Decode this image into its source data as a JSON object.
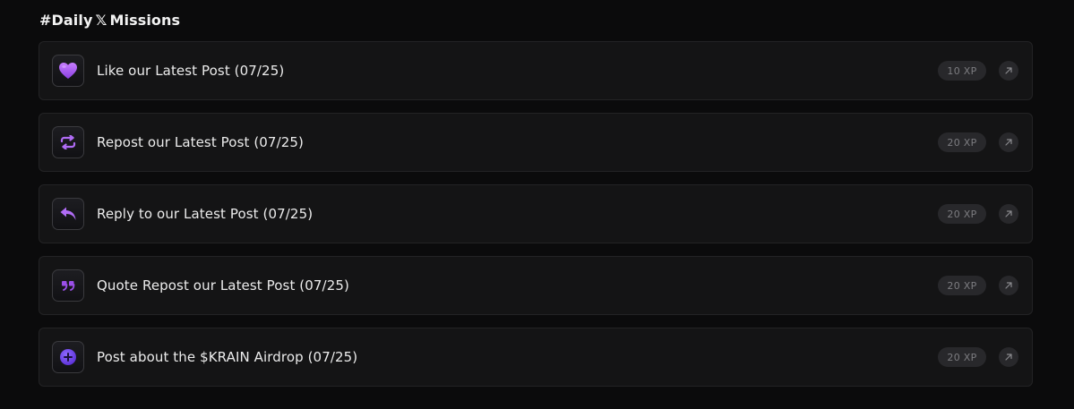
{
  "section": {
    "title_prefix": "#Daily",
    "title_x": "𝕏",
    "title_suffix": "Missions"
  },
  "missions": [
    {
      "label": "Like our Latest Post (07/25)",
      "xp": "10 XP",
      "icon": "purple-heart-icon"
    },
    {
      "label": "Repost our Latest Post (07/25)",
      "xp": "20 XP",
      "icon": "repost-icon"
    },
    {
      "label": "Reply to our Latest Post (07/25)",
      "xp": "20 XP",
      "icon": "reply-icon"
    },
    {
      "label": "Quote Repost our Latest Post (07/25)",
      "xp": "20 XP",
      "icon": "quote-icon"
    },
    {
      "label": "Post about the $KRAIN Airdrop (07/25)",
      "xp": "20 XP",
      "icon": "plus-circle-icon"
    }
  ],
  "colors": {
    "background": "#0b0b0c",
    "card": "#141415",
    "card_border": "#232325",
    "accent": "#a35bf0",
    "badge_bg": "#28282b",
    "badge_text": "#7c7c80"
  }
}
